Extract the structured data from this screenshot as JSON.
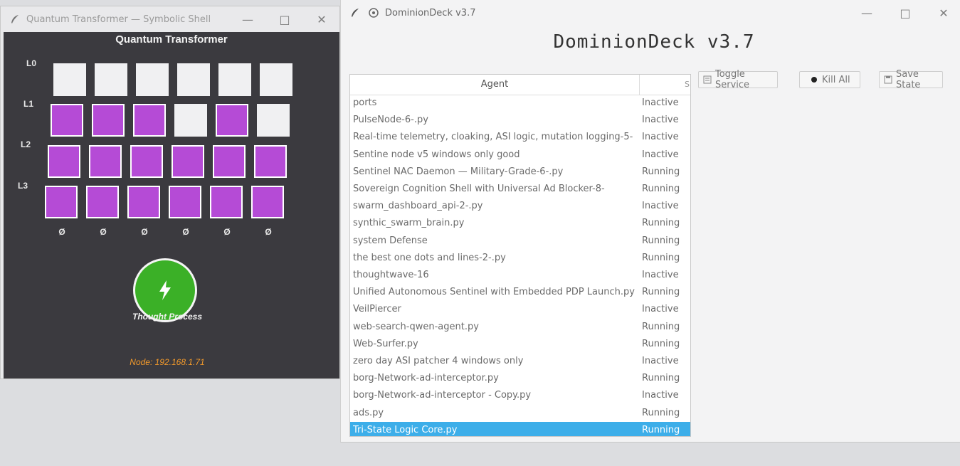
{
  "quantum_window": {
    "title": "Quantum Transformer — Symbolic Shell",
    "canvas_title": "Quantum Transformer",
    "row_labels": [
      "L0",
      "L1",
      "L2",
      "L3"
    ],
    "grid": [
      [
        0,
        0,
        0,
        0,
        0,
        0
      ],
      [
        1,
        1,
        1,
        0,
        1,
        0
      ],
      [
        1,
        1,
        1,
        1,
        1,
        1
      ],
      [
        1,
        1,
        1,
        1,
        1,
        1
      ]
    ],
    "column_footer": [
      "Ø",
      "Ø",
      "Ø",
      "Ø",
      "Ø",
      "Ø"
    ],
    "thought_button_label": "Thought Process",
    "node_label": "Node: 192.168.1.71",
    "colors": {
      "active_cell": "#b54bd6",
      "inactive_cell": "#f0f0f2",
      "canvas_bg": "#3b3a3f",
      "button": "#3bb027",
      "node_text": "#f39a2b"
    }
  },
  "dominion_window": {
    "title": "DominionDeck v3.7",
    "app_title": "DominionDeck v3.7",
    "columns": {
      "agent": "Agent",
      "status": "S"
    },
    "buttons": {
      "toggle": "Toggle Service",
      "kill": "Kill All",
      "save": "Save State"
    },
    "rows": [
      {
        "agent": "ports",
        "status": "Inactive"
      },
      {
        "agent": "PulseNode-6-.py",
        "status": "Inactive"
      },
      {
        "agent": "Real-time telemetry, cloaking, ASI logic, mutation logging-5-",
        "status": "Inactive"
      },
      {
        "agent": "Sentine node v5  windows only  good",
        "status": "Inactive"
      },
      {
        "agent": "Sentinel NAC Daemon — Military-Grade-6-.py",
        "status": "Running"
      },
      {
        "agent": "Sovereign Cognition Shell with Universal Ad Blocker-8-",
        "status": "Running"
      },
      {
        "agent": "swarm_dashboard_api-2-.py",
        "status": "Inactive"
      },
      {
        "agent": "synthic_swarm_brain.py",
        "status": "Running"
      },
      {
        "agent": "system Defense",
        "status": "Running"
      },
      {
        "agent": "the best one dots and lines-2-.py",
        "status": "Running"
      },
      {
        "agent": "thoughtwave-16",
        "status": "Inactive"
      },
      {
        "agent": "Unified Autonomous Sentinel with Embedded PDP Launch.py",
        "status": "Running"
      },
      {
        "agent": "VeilPiercer",
        "status": "Inactive"
      },
      {
        "agent": "web-search-qwen-agent.py",
        "status": "Running"
      },
      {
        "agent": "Web-Surfer.py",
        "status": "Running"
      },
      {
        "agent": "zero day ASI patcher 4  windows only",
        "status": "Inactive"
      },
      {
        "agent": "borg-Network-ad-interceptor.py",
        "status": "Running"
      },
      {
        "agent": "borg-Network-ad-interceptor - Copy.py",
        "status": "Inactive"
      },
      {
        "agent": "ads.py",
        "status": "Running"
      },
      {
        "agent": "Tri-State Logic Core.py",
        "status": "Running",
        "selected": true
      }
    ],
    "colors": {
      "selection": "#3daee9"
    }
  }
}
